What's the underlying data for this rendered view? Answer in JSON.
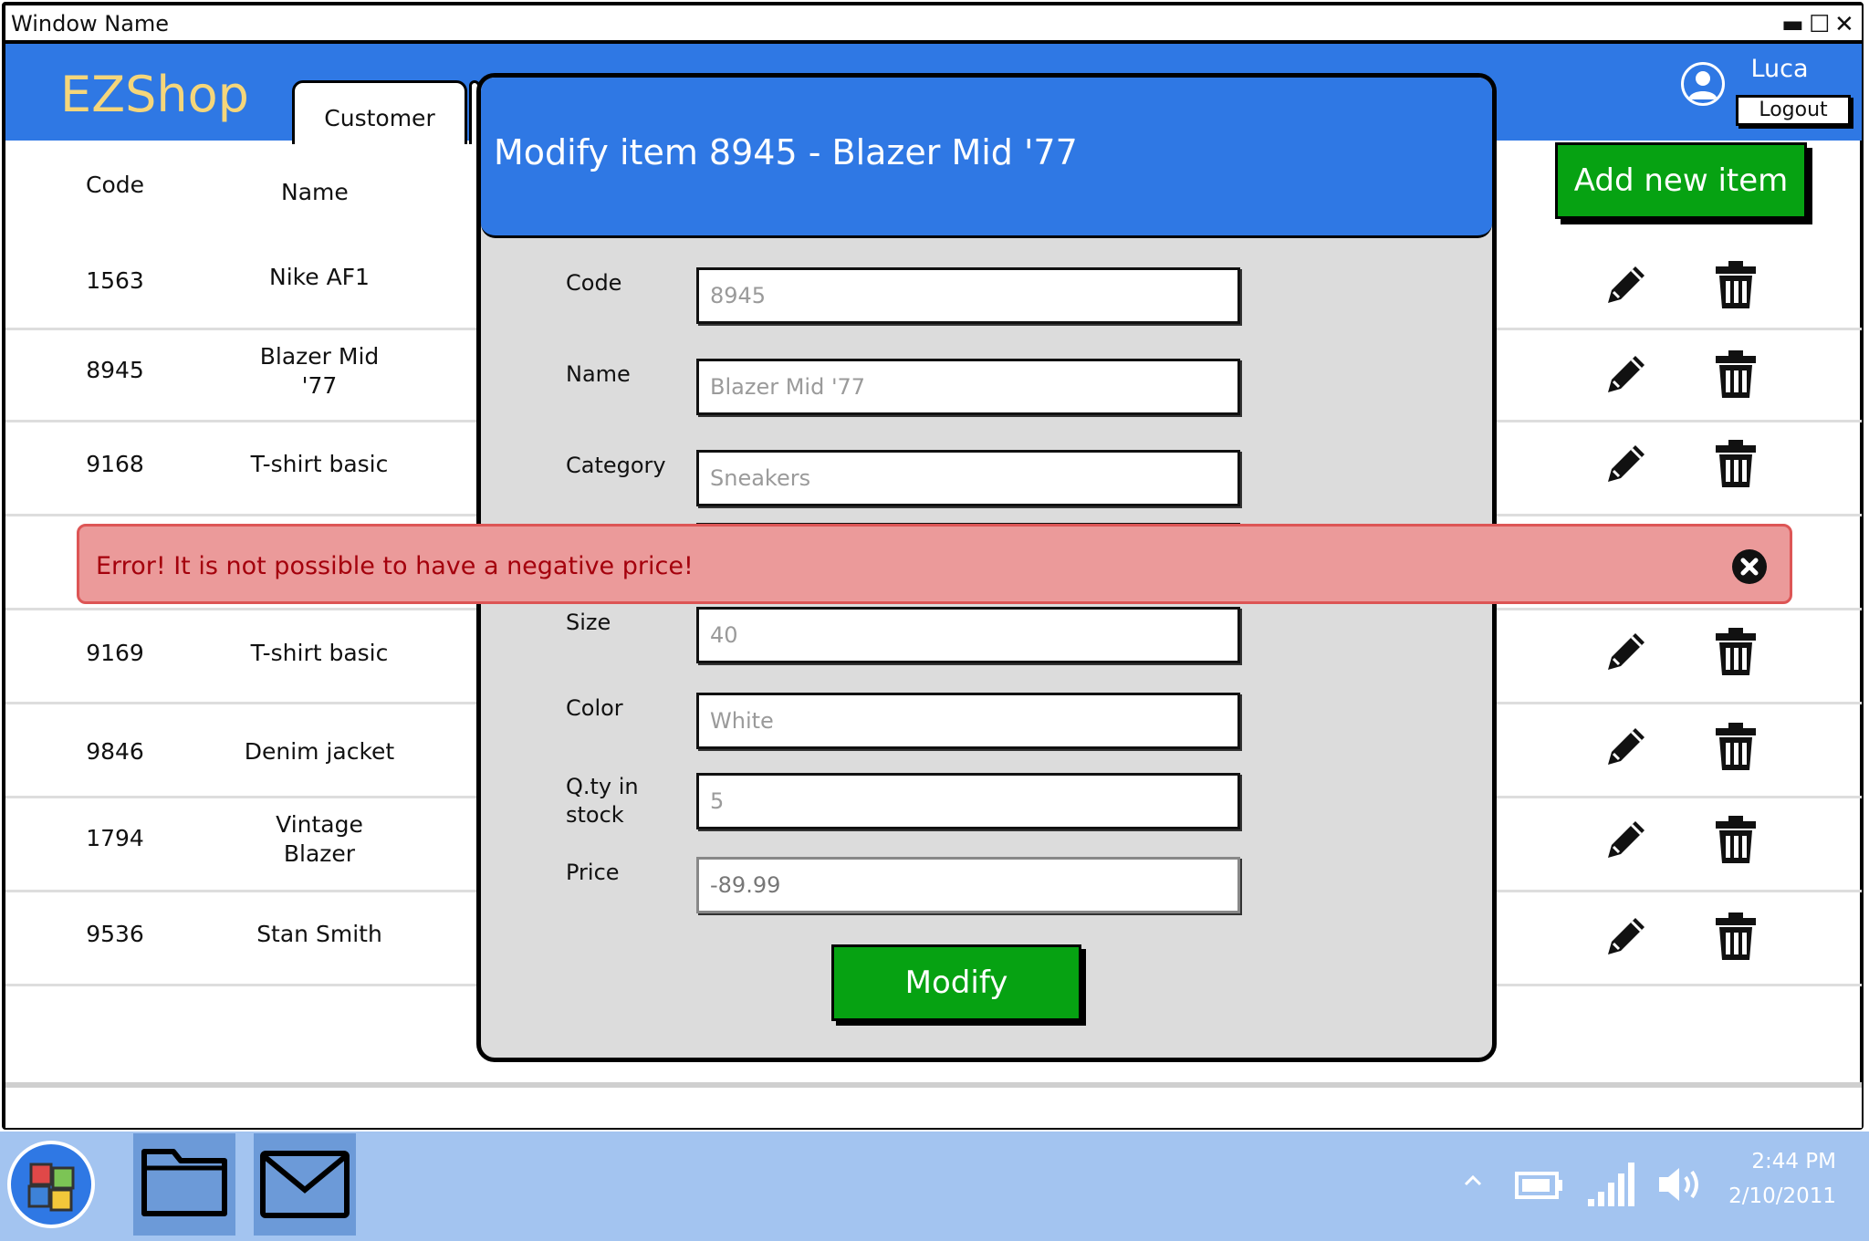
{
  "window": {
    "title": "Window Name"
  },
  "app": {
    "logo": "EZShop",
    "tab_customer": "Customer"
  },
  "user": {
    "name": "Luca",
    "logout_label": "Logout"
  },
  "table": {
    "headers": {
      "code": "Code",
      "name": "Name"
    },
    "rows": [
      {
        "code": "1563",
        "name": "Nike AF1"
      },
      {
        "code": "8945",
        "name": "Blazer Mid\n'77"
      },
      {
        "code": "9168",
        "name": "T-shirt basic"
      },
      {
        "code": "9169",
        "name": "T-shirt basic"
      },
      {
        "code": "9846",
        "name": "Denim jacket"
      },
      {
        "code": "1794",
        "name": "Vintage\nBlazer"
      },
      {
        "code": "9536",
        "name": "Stan Smith"
      }
    ]
  },
  "add_button": "Add new item",
  "modal": {
    "title": "Modify item 8945 - Blazer Mid '77",
    "labels": {
      "code": "Code",
      "name": "Name",
      "category": "Category",
      "size": "Size",
      "color": "Color",
      "qty": "Q.ty in\nstock",
      "price": "Price"
    },
    "values": {
      "code": "8945",
      "name": "Blazer Mid '77",
      "category": "Sneakers",
      "size": "40",
      "color": "White",
      "qty": "5",
      "price": "-89.99"
    },
    "modify_button": "Modify"
  },
  "error": {
    "message": "Error! It is not possible to have a negative price!"
  },
  "taskbar": {
    "time": "2:44 PM",
    "date": "2/10/2011"
  },
  "colors": {
    "brand_blue": "#2f78e4",
    "logo_yellow": "#f5d67a",
    "button_green": "#06a212",
    "error_bg": "#eb9a9a",
    "error_text": "#a4000c",
    "taskbar": "#a3c4f0"
  },
  "icons": [
    "pencil-icon",
    "trash-icon",
    "close-circle-icon",
    "user-icon",
    "start-icon",
    "folder-icon",
    "mail-icon",
    "battery-icon",
    "signal-icon",
    "volume-icon",
    "chevron-up-icon"
  ]
}
